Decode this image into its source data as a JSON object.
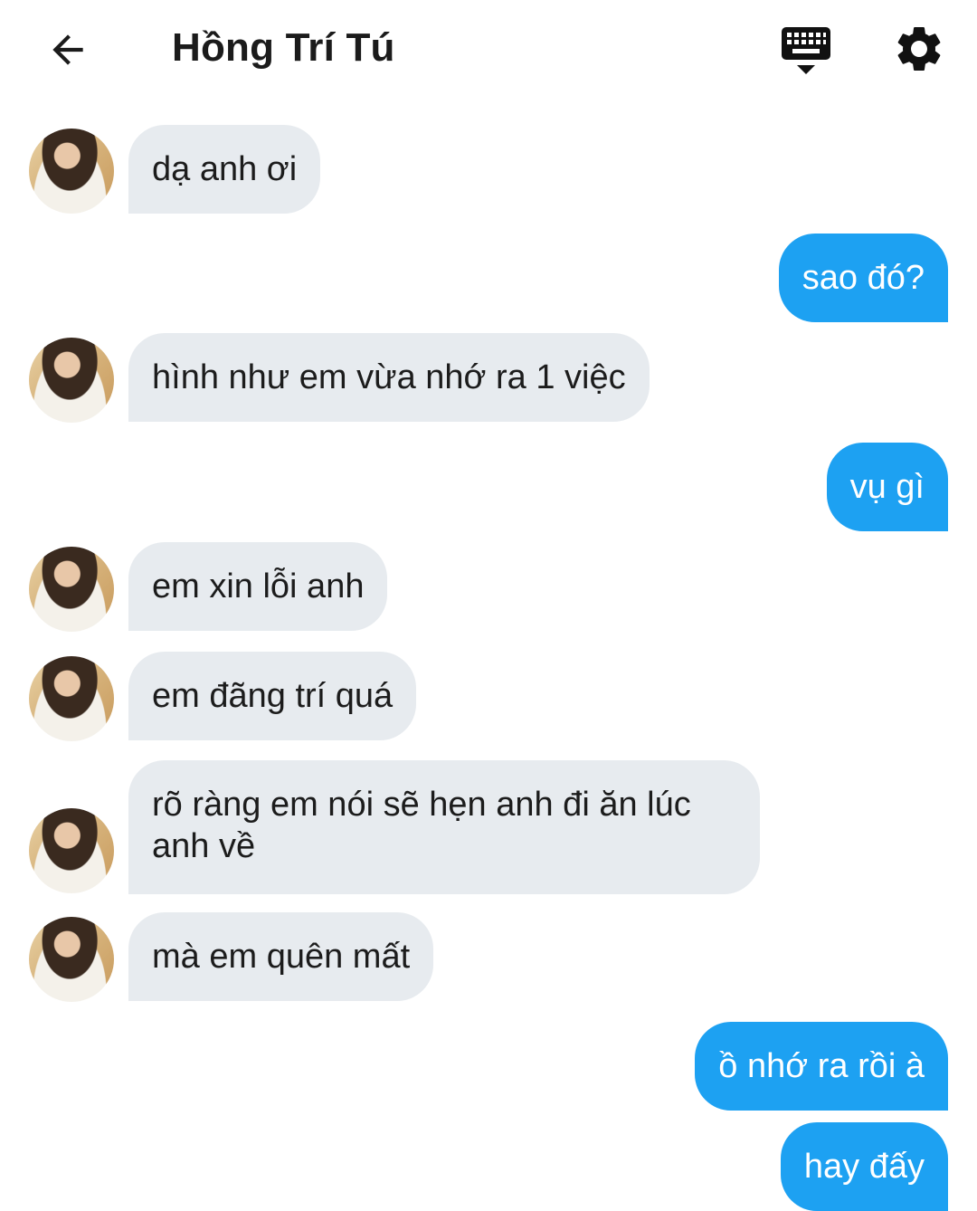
{
  "header": {
    "title": "Hồng Trí Tú",
    "back_icon": "arrow-left-icon",
    "keyboard_icon": "keyboard-icon",
    "settings_icon": "gear-icon"
  },
  "colors": {
    "incoming_bubble": "#e7ebef",
    "outgoing_bubble": "#1da1f2",
    "incoming_text": "#1c1c1c",
    "outgoing_text": "#ffffff"
  },
  "messages": [
    {
      "direction": "incoming",
      "text": "dạ anh ơi"
    },
    {
      "direction": "outgoing",
      "text": "sao đó?"
    },
    {
      "direction": "incoming",
      "text": "hình như em vừa nhớ ra 1 việc"
    },
    {
      "direction": "outgoing",
      "text": "vụ gì"
    },
    {
      "direction": "incoming",
      "text": "em xin lỗi anh"
    },
    {
      "direction": "incoming",
      "text": "em đãng trí quá"
    },
    {
      "direction": "incoming",
      "text": "rõ ràng em nói sẽ hẹn anh đi ăn lúc anh về"
    },
    {
      "direction": "incoming",
      "text": "mà em quên mất"
    },
    {
      "direction": "outgoing",
      "text": "ồ nhớ ra rồi à"
    },
    {
      "direction": "outgoing",
      "text": "hay đấy"
    }
  ]
}
